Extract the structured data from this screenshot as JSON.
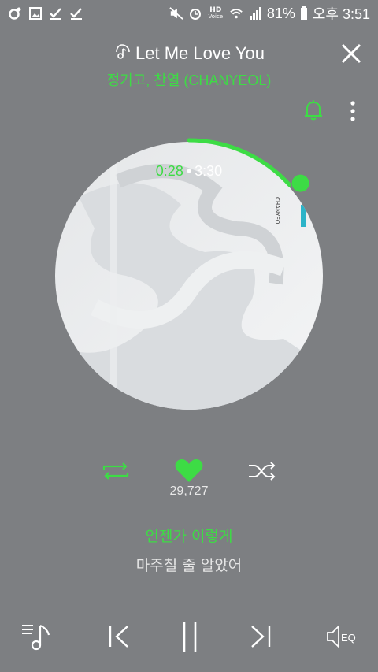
{
  "status_bar": {
    "battery_percent": "81%",
    "time": "오후 3:51",
    "hd_label": "HD",
    "voice_label": "Voice",
    "icons": [
      "notification-ring-icon",
      "image-icon",
      "check-icon",
      "check-icon",
      "mute-icon",
      "alarm-icon",
      "wifi-icon",
      "signal-icon",
      "battery-icon"
    ]
  },
  "header": {
    "song_title": "Let Me Love You",
    "artist": "정기고, 찬열 (CHANYEOL)",
    "icons": [
      "music-note-icon",
      "close-icon",
      "bell-icon",
      "more-vertical-icon"
    ]
  },
  "player": {
    "current_time": "0:28",
    "separator": "•",
    "total_time": "3:30",
    "progress_fraction": 0.133,
    "cover_label": "CHANYEOL"
  },
  "actions": {
    "like_count": "29,727",
    "icons": [
      "repeat-icon",
      "heart-icon",
      "shuffle-icon"
    ]
  },
  "lyrics": {
    "current_line": "언젠가 이렇게",
    "next_line": "마주칠 줄 알았어"
  },
  "bottom_bar": {
    "eq_label": "EQ",
    "icons": [
      "playlist-icon",
      "previous-icon",
      "pause-icon",
      "next-icon",
      "equalizer-icon"
    ]
  },
  "colors": {
    "accent": "#3ddc45",
    "background": "#7d7f82",
    "text": "#ffffff"
  }
}
